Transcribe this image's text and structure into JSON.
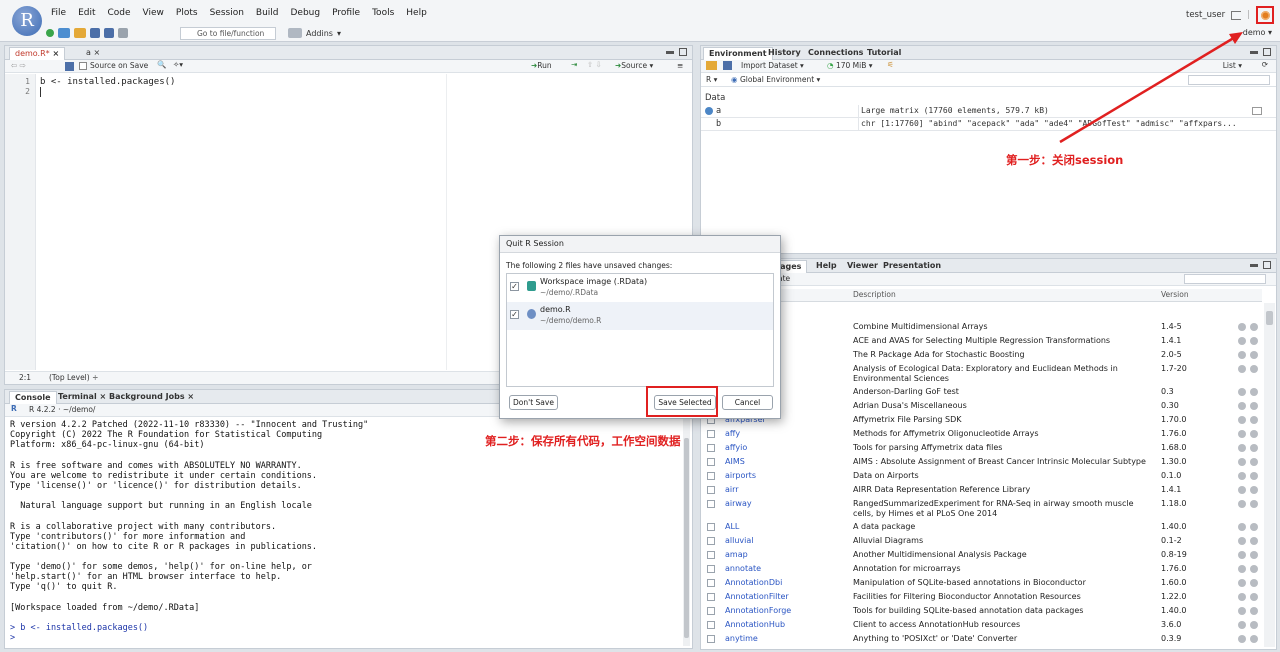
{
  "app": {
    "logo_letter": "R"
  },
  "menus": [
    "File",
    "Edit",
    "Code",
    "View",
    "Plots",
    "Session",
    "Build",
    "Debug",
    "Profile",
    "Tools",
    "Help"
  ],
  "user": {
    "name": "test_user"
  },
  "toolbar": {
    "goto_placeholder": "Go to file/function",
    "addins_label": "Addins",
    "project_label": "demo"
  },
  "editor": {
    "tabs": [
      {
        "label": "demo.R*"
      },
      {
        "label": "a"
      }
    ],
    "source_on_save_label": "Source on Save",
    "run_label": "Run",
    "source_label": "Source",
    "line_numbers": [
      "1",
      "2"
    ],
    "code_lines": [
      "b <- installed.packages()",
      ""
    ],
    "status_position": "2:1",
    "status_scope": "(Top Level)"
  },
  "console": {
    "tabs": [
      "Console",
      "Terminal",
      "Background Jobs"
    ],
    "r_version_label": "R 4.2.2 · ~/demo/",
    "lines": [
      "R version 4.2.2 Patched (2022-11-10 r83330) -- \"Innocent and Trusting\"",
      "Copyright (C) 2022 The R Foundation for Statistical Computing",
      "Platform: x86_64-pc-linux-gnu (64-bit)",
      "",
      "R is free software and comes with ABSOLUTELY NO WARRANTY.",
      "You are welcome to redistribute it under certain conditions.",
      "Type 'license()' or 'licence()' for distribution details.",
      "",
      "  Natural language support but running in an English locale",
      "",
      "R is a collaborative project with many contributors.",
      "Type 'contributors()' for more information and",
      "'citation()' on how to cite R or R packages in publications.",
      "",
      "Type 'demo()' for some demos, 'help()' for on-line help, or",
      "'help.start()' for an HTML browser interface to help.",
      "Type 'q()' to quit R.",
      "",
      "[Workspace loaded from ~/demo/.RData]",
      ""
    ],
    "command_line": "> b <- installed.packages()",
    "prompt": ">"
  },
  "environment": {
    "tabs": [
      "Environment",
      "History",
      "Connections",
      "Tutorial"
    ],
    "import_label": "Import Dataset",
    "memory_label": "170 MiB",
    "list_label": "List",
    "lang_label": "R",
    "scope_label": "Global Environment",
    "section_label": "Data",
    "rows": [
      {
        "name": "a",
        "value": "Large matrix (17760 elements,  579.7 kB)"
      },
      {
        "name": "b",
        "value": "chr [1:17760] \"abind\" \"acepack\" \"ada\" \"ade4\" \"ADGofTest\" \"admisc\" \"affxpars..."
      }
    ]
  },
  "packages": {
    "tabs": [
      "Packages",
      "Help",
      "Viewer",
      "Presentation"
    ],
    "update_label": "Update",
    "columns": [
      "Description",
      "Version"
    ],
    "rows": [
      {
        "name": "",
        "desc": "Combine Multidimensional Arrays",
        "ver": "1.4-5"
      },
      {
        "name": "",
        "desc": "ACE and AVAS for Selecting Multiple Regression Transformations",
        "ver": "1.4.1"
      },
      {
        "name": "",
        "desc": "The R Package Ada for Stochastic Boosting",
        "ver": "2.0-5"
      },
      {
        "name": "",
        "desc": "Analysis of Ecological Data: Exploratory and Euclidean Methods in Environmental Sciences",
        "ver": "1.7-20"
      },
      {
        "name": "",
        "desc": "Anderson-Darling GoF test",
        "ver": "0.3"
      },
      {
        "name": "",
        "desc": "Adrian Dusa's Miscellaneous",
        "ver": "0.30"
      },
      {
        "name": "affxparser",
        "desc": "Affymetrix File Parsing SDK",
        "ver": "1.70.0"
      },
      {
        "name": "affy",
        "desc": "Methods for Affymetrix Oligonucleotide Arrays",
        "ver": "1.76.0"
      },
      {
        "name": "affyio",
        "desc": "Tools for parsing Affymetrix data files",
        "ver": "1.68.0"
      },
      {
        "name": "AIMS",
        "desc": "AIMS : Absolute Assignment of Breast Cancer Intrinsic Molecular Subtype",
        "ver": "1.30.0"
      },
      {
        "name": "airports",
        "desc": "Data on Airports",
        "ver": "0.1.0"
      },
      {
        "name": "airr",
        "desc": "AIRR Data Representation Reference Library",
        "ver": "1.4.1"
      },
      {
        "name": "airway",
        "desc": "RangedSummarizedExperiment for RNA-Seq in airway smooth muscle cells, by Himes et al PLoS One 2014",
        "ver": "1.18.0"
      },
      {
        "name": "ALL",
        "desc": "A data package",
        "ver": "1.40.0"
      },
      {
        "name": "alluvial",
        "desc": "Alluvial Diagrams",
        "ver": "0.1-2"
      },
      {
        "name": "amap",
        "desc": "Another Multidimensional Analysis Package",
        "ver": "0.8-19"
      },
      {
        "name": "annotate",
        "desc": "Annotation for microarrays",
        "ver": "1.76.0"
      },
      {
        "name": "AnnotationDbi",
        "desc": "Manipulation of SQLite-based annotations in Bioconductor",
        "ver": "1.60.0"
      },
      {
        "name": "AnnotationFilter",
        "desc": "Facilities for Filtering Bioconductor Annotation Resources",
        "ver": "1.22.0"
      },
      {
        "name": "AnnotationForge",
        "desc": "Tools for building SQLite-based annotation data packages",
        "ver": "1.40.0"
      },
      {
        "name": "AnnotationHub",
        "desc": "Client to access AnnotationHub resources",
        "ver": "3.6.0"
      },
      {
        "name": "anytime",
        "desc": "Anything to 'POSIXct' or 'Date' Converter",
        "ver": "0.3.9"
      }
    ]
  },
  "dialog": {
    "title": "Quit R Session",
    "message": "The following 2 files have unsaved changes:",
    "files": [
      {
        "name": "Workspace image (.RData)",
        "path": "~/demo/.RData"
      },
      {
        "name": "demo.R",
        "path": "~/demo/demo.R"
      }
    ],
    "dont_save_label": "Don't Save",
    "save_selected_label": "Save Selected",
    "cancel_label": "Cancel"
  },
  "annotations": {
    "step1": "第一步：关闭session",
    "step2": "第二步：保存所有代码，工作空间数据"
  },
  "colors": {
    "annotation_red": "#e02020",
    "link_blue": "#2a55c3",
    "console_blue": "#1d35a8"
  }
}
